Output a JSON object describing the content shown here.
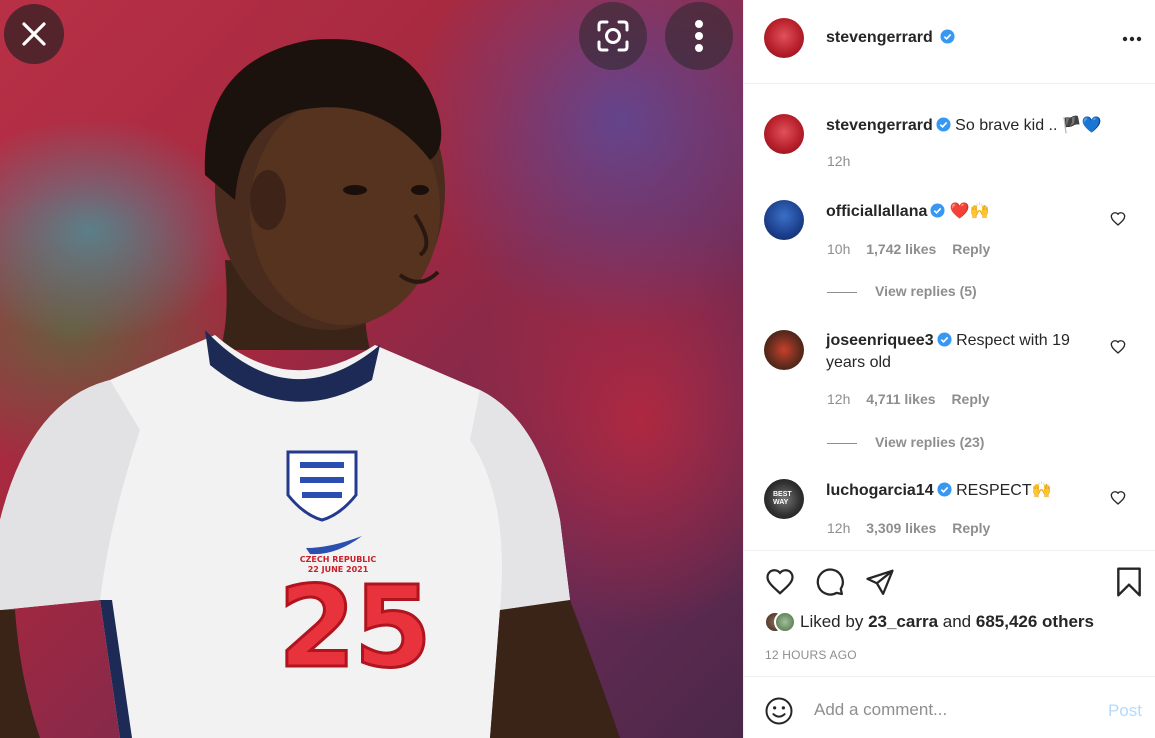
{
  "photo": {
    "close_icon": "close-icon",
    "lens_icon": "lens-icon",
    "more_icon": "more-vertical-icon",
    "shirt_text_line1": "CZECH REPUBLIC",
    "shirt_text_line2": "22 JUNE 2021",
    "shirt_number": "25"
  },
  "header": {
    "username": "stevengerrard",
    "more_icon": "more-horizontal-icon"
  },
  "caption": {
    "username": "stevengerrard",
    "text": "So brave kid .. 🏴💙",
    "time": "12h"
  },
  "comments": [
    {
      "username": "officiallallana",
      "text": "❤️🙌",
      "time": "10h",
      "likes": "1,742 likes",
      "reply": "Reply",
      "view_replies": "View replies (5)"
    },
    {
      "username": "joseenriquee3",
      "text_line1": "Respect with 19",
      "text_line2": "years old",
      "time": "12h",
      "likes": "4,711 likes",
      "reply": "Reply",
      "view_replies": "View replies (23)"
    },
    {
      "username": "luchogarcia14",
      "text": "RESPECT🙌",
      "avatar_text": "BEST WAY",
      "time": "12h",
      "likes": "3,309 likes",
      "reply": "Reply"
    }
  ],
  "actions": {
    "liked_by_prefix": "Liked by",
    "liked_by_user": "23_carra",
    "liked_by_and": "and",
    "liked_by_others": "685,426 others",
    "timestamp": "12 HOURS AGO"
  },
  "comment_box": {
    "placeholder": "Add a comment...",
    "post_label": "Post"
  },
  "colors": {
    "verified": "#3897f0",
    "muted": "#8e8e8e",
    "text": "#262626",
    "post_disabled": "#b3dbff"
  }
}
